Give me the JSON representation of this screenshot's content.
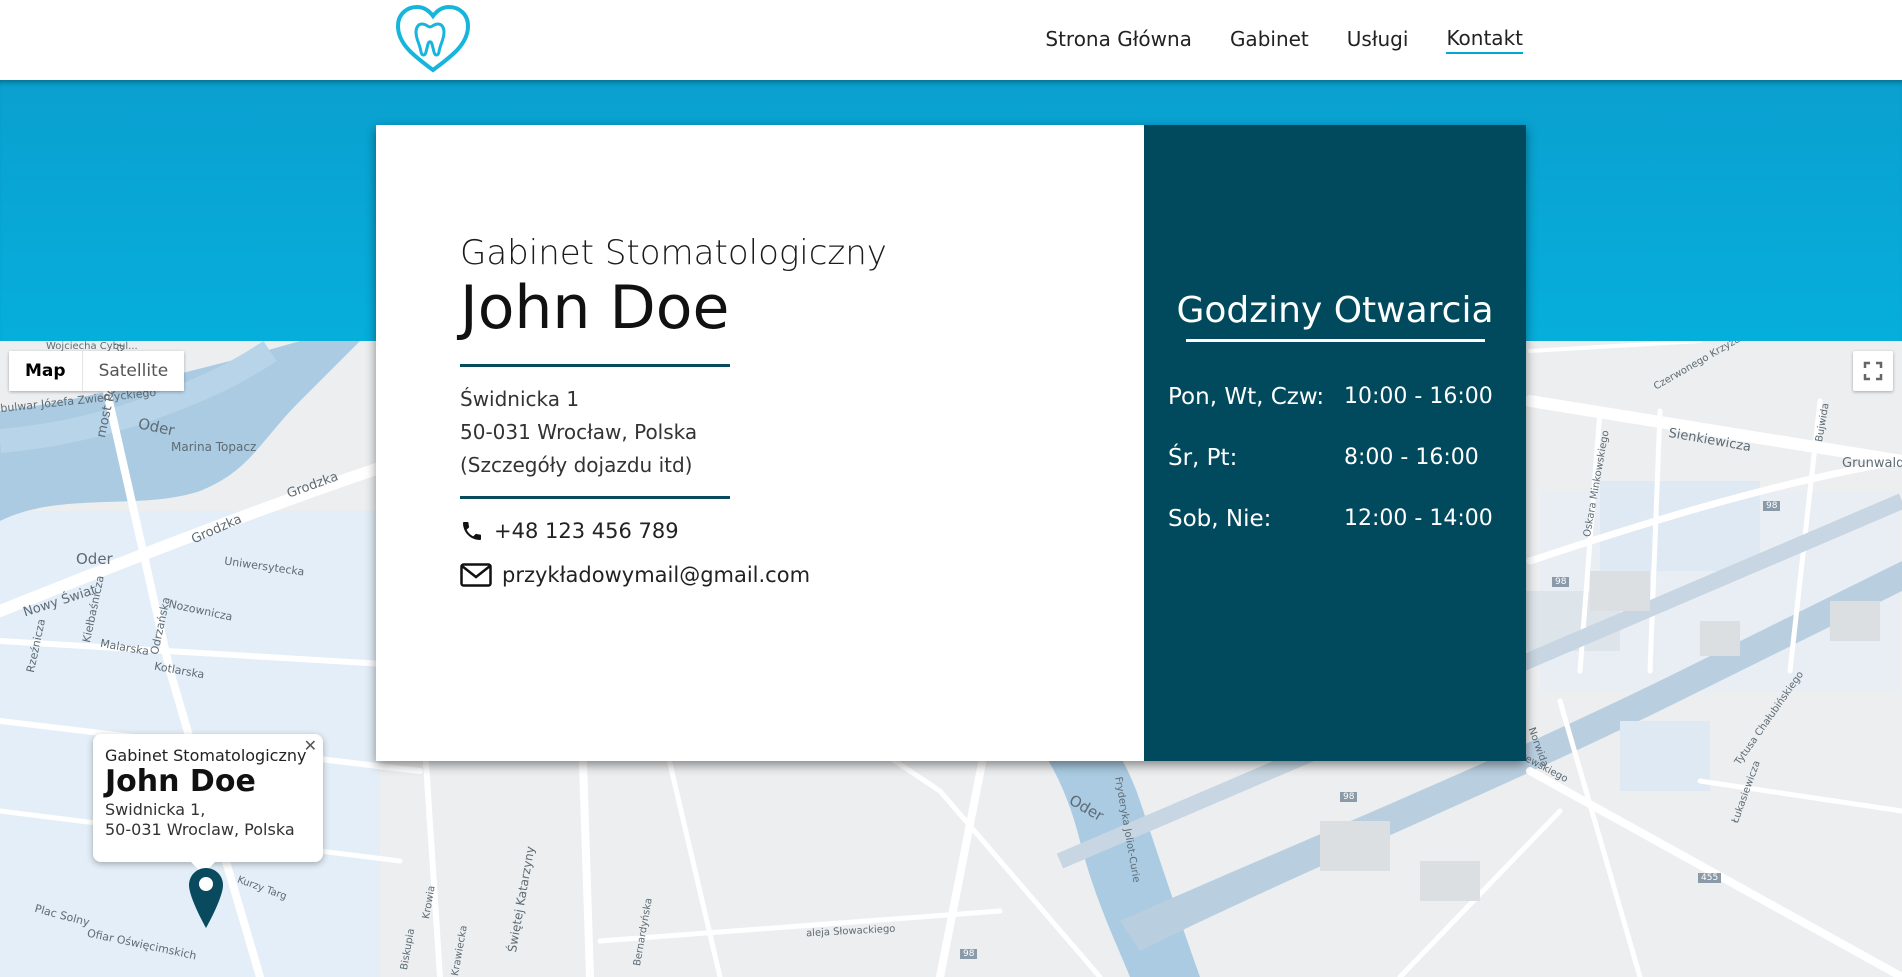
{
  "header": {
    "nav": [
      {
        "label": "Strona Główna",
        "active": false
      },
      {
        "label": "Gabinet",
        "active": false
      },
      {
        "label": "Usługi",
        "active": false
      },
      {
        "label": "Kontakt",
        "active": true
      }
    ],
    "accent": "#00a7d0"
  },
  "card": {
    "subtitle": "Gabinet Stomatologiczny",
    "title": "John Doe",
    "address": [
      "Świdnicka 1",
      "50-031 Wrocław, Polska",
      "(Szczegóły dojazdu itd)"
    ],
    "phone": "+48 123 456 789",
    "email": "przykładowymail@gmail.com",
    "dark_color": "#014a5d"
  },
  "hours": {
    "title": "Godziny Otwarcia",
    "rows": [
      {
        "days": "Pon, Wt, Czw:",
        "time": "10:00 - 16:00"
      },
      {
        "days": "Śr, Pt:",
        "time": "8:00 - 16:00"
      },
      {
        "days": "Sob, Nie:",
        "time": "12:00 - 14:00"
      }
    ]
  },
  "map": {
    "type_buttons": [
      "Map",
      "Satellite"
    ],
    "selected_type": "Map",
    "infowindow": {
      "subtitle": "Gabinet Stomatologiczny",
      "title": "John Doe",
      "line1": "Swidnicka 1,",
      "line2": "50-031 Wroclaw, Polska"
    },
    "labels": [
      "Wojciecha Cybul...",
      "bulwar Józefa Zwierzyckiego",
      "Oder",
      "most Pomorski",
      "Marina Topacz",
      "Grodzka",
      "Grodzka",
      "Oder",
      "Uniwersytecka",
      "Nowy Świat",
      "Nozownicza",
      "Kiełbaśnicza",
      "Malarska",
      "Odrzańska",
      "Kotlarska",
      "Rzeźnicza",
      "Kurzy Targ",
      "Plac Solny",
      "Ofiar Oświęcimskich",
      "Świętej Katarzyny",
      "Krowia",
      "Bernardyńska",
      "Biskupia",
      "Krawiecka",
      "aleja Słowackiego",
      "Oder",
      "Fryderyka Joliot-Curie",
      "Sienkiewicza",
      "Grunwaldzka",
      "Oskara Minkowskiego",
      "Bujwida",
      "Norwida",
      "Tytusa Chałubińskiego",
      "Janiszewskiego",
      "Łukasiewicza",
      "Czerwonego Krzyża",
      "98",
      "98",
      "98",
      "98",
      "455"
    ],
    "marker_color": "#0a4a5e"
  }
}
